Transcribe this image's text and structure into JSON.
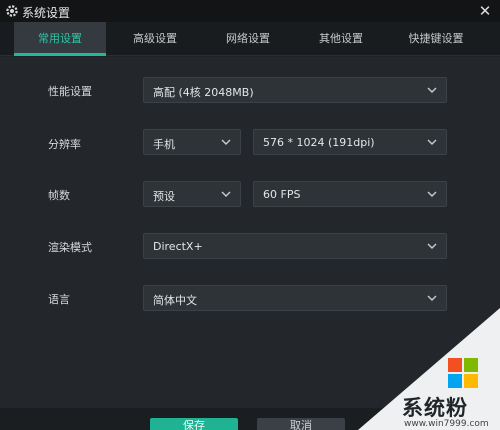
{
  "window": {
    "title": "系统设置",
    "close_glyph": "✕"
  },
  "tabs": [
    {
      "label": "常用设置",
      "active": true
    },
    {
      "label": "高级设置",
      "active": false
    },
    {
      "label": "网络设置",
      "active": false
    },
    {
      "label": "其他设置",
      "active": false
    },
    {
      "label": "快捷键设置",
      "active": false
    }
  ],
  "settings": {
    "performance": {
      "label": "性能设置",
      "value": "高配 (4核 2048MB)"
    },
    "resolution": {
      "label": "分辨率",
      "mode": "手机",
      "value": "576 * 1024 (191dpi)"
    },
    "fps": {
      "label": "帧数",
      "mode": "预设",
      "value": "60 FPS"
    },
    "render_mode": {
      "label": "渲染模式",
      "value": "DirectX+"
    },
    "language": {
      "label": "语言",
      "value": "简体中文"
    }
  },
  "footer": {
    "confirm_label": "保存",
    "cancel_label": "取消"
  },
  "watermark": {
    "text": "系统粉",
    "url": "www.win7999.com"
  },
  "colors": {
    "accent": "#22b89a",
    "background": "#23262a",
    "select_bg": "#2e3338"
  }
}
